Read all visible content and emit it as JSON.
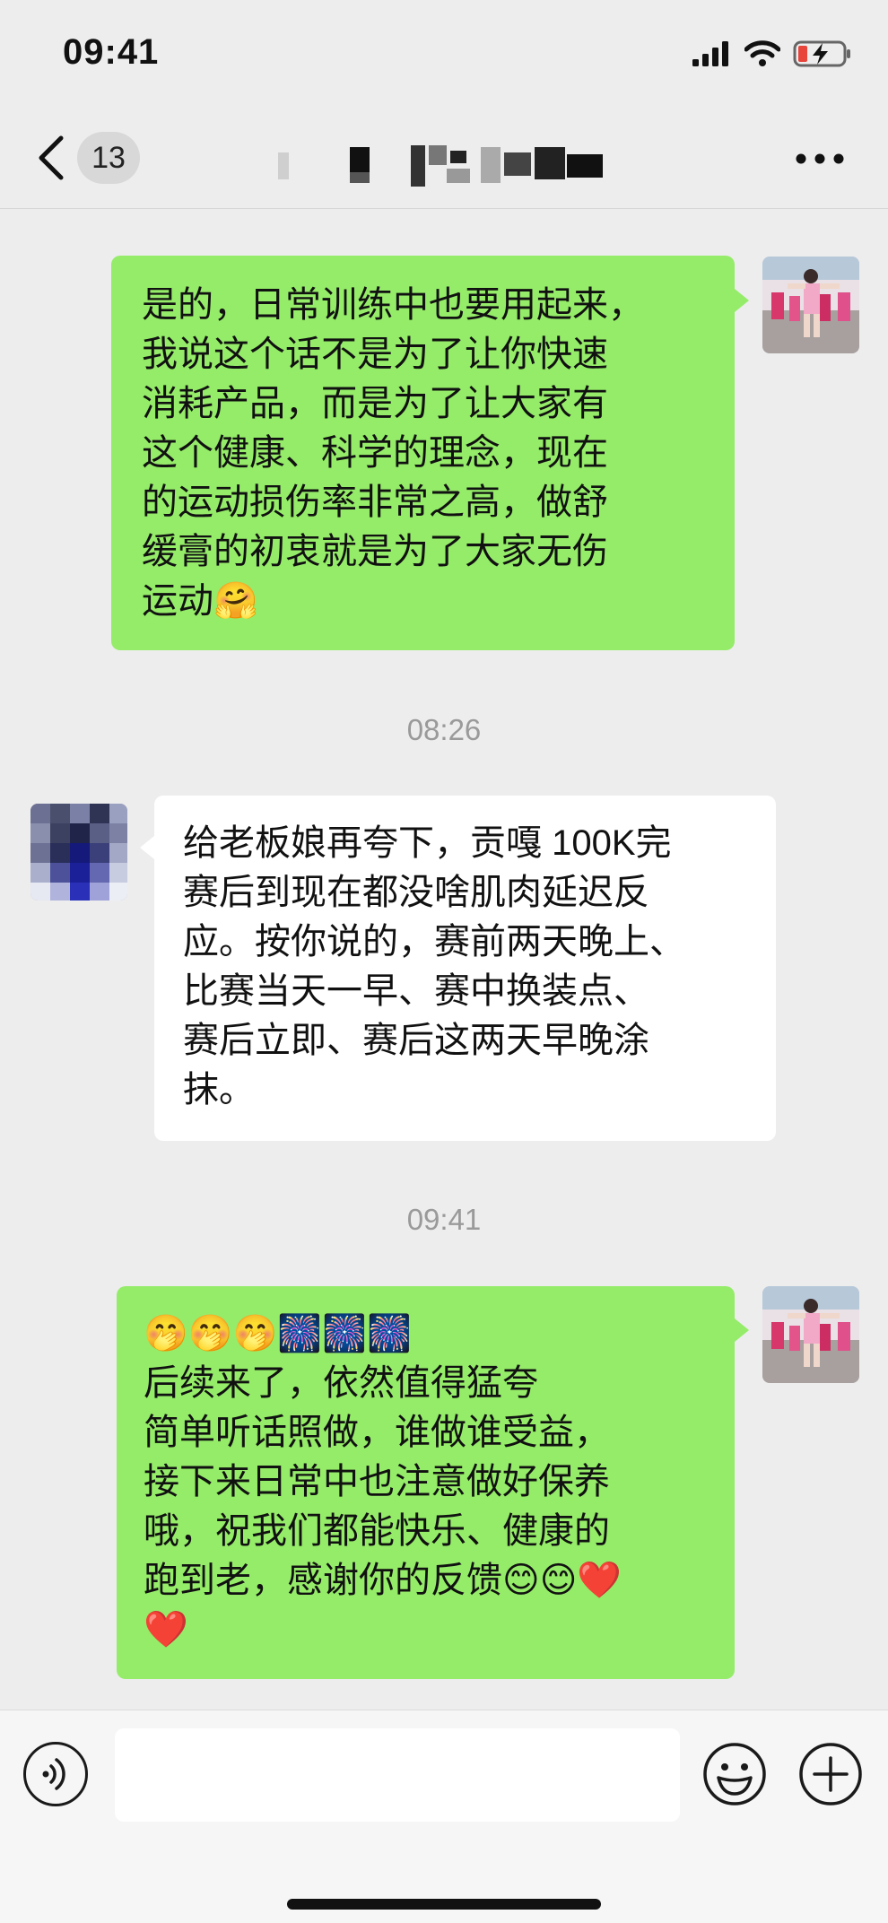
{
  "status_bar": {
    "time": "09:41"
  },
  "nav": {
    "unread_count": "13"
  },
  "messages": [
    {
      "side": "right",
      "text": "是的，日常训练中也要用起来，\n我说这个话不是为了让你快速\n消耗产品，而是为了让大家有\n这个健康、科学的理念，现在\n的运动损伤率非常之高，做舒\n缓膏的初衷就是为了大家无伤\n运动🤗"
    },
    {
      "timestamp": "08:26"
    },
    {
      "side": "left",
      "text": "给老板娘再夸下，贡嘎 100K完\n赛后到现在都没啥肌肉延迟反\n应。按你说的，赛前两天晚上、\n比赛当天一早、赛中换装点、\n赛后立即、赛后这两天早晚涂\n抹。"
    },
    {
      "timestamp": "09:41"
    },
    {
      "side": "right",
      "text": "🤭🤭🤭🎆🎆🎆\n后续来了，依然值得猛夸\n简单听话照做，谁做谁受益，\n接下来日常中也注意做好保养\n哦，祝我们都能快乐、健康的\n跑到老，感谢你的反馈😊😊❤️\n❤️"
    }
  ],
  "colors": {
    "background": "#ededed",
    "bubble_self": "#95ec69",
    "bubble_other": "#ffffff",
    "timestamp": "#9a9a9a"
  },
  "icons": [
    "signal-icon",
    "wifi-icon",
    "battery-charging-icon",
    "back-chevron-icon",
    "more-icon",
    "voice-icon",
    "emoji-icon",
    "plus-icon"
  ]
}
